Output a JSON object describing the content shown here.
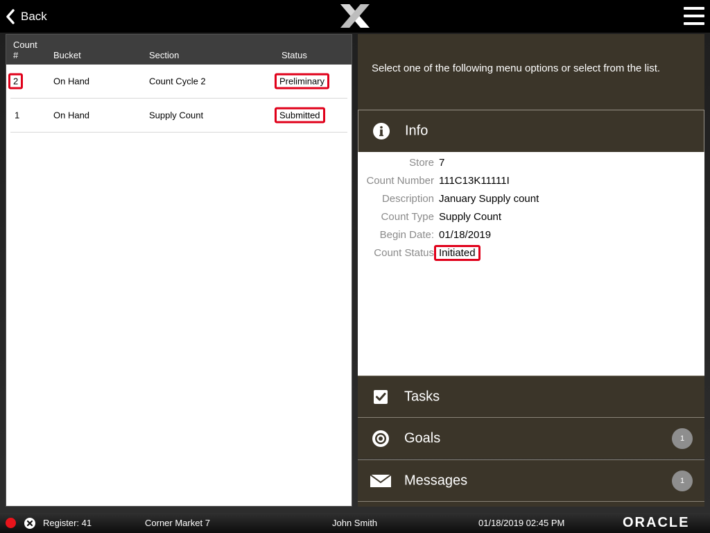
{
  "topbar": {
    "back_label": "Back"
  },
  "list": {
    "headers": {
      "count": "Count\n#",
      "count_line1": "Count",
      "count_line2": "#",
      "bucket": "Bucket",
      "section": "Section",
      "status": "Status"
    },
    "rows": [
      {
        "count": "2",
        "bucket": "On Hand",
        "section": "Count Cycle 2",
        "status": "Preliminary"
      },
      {
        "count": "1",
        "bucket": "On Hand",
        "section": "Supply Count",
        "status": "Submitted"
      }
    ]
  },
  "right": {
    "intro": "Select one of the following menu options or select from the list.",
    "info_title": "Info",
    "info": [
      {
        "label": "Store",
        "value": "7"
      },
      {
        "label": "Count Number",
        "value": "111C13K11111I"
      },
      {
        "label": "Description",
        "value": "January Supply count"
      },
      {
        "label": "Count Type",
        "value": "Supply Count"
      },
      {
        "label": "Begin Date:",
        "value": "01/18/2019"
      },
      {
        "label": "Count Status",
        "value": "Initiated"
      }
    ],
    "nav": [
      {
        "label": "Tasks",
        "icon": "checkbox-icon"
      },
      {
        "label": "Goals",
        "icon": "target-icon",
        "badge": "1"
      },
      {
        "label": "Messages",
        "icon": "envelope-icon",
        "badge": "1"
      }
    ]
  },
  "statusbar": {
    "register": "Register: 41",
    "store": "Corner Market 7",
    "user": "John Smith",
    "datetime": "01/18/2019 02:45 PM",
    "brand": "ORACLE"
  },
  "colors": {
    "panel_brown": "#3b3529",
    "highlight_red": "#e0001a",
    "status_red": "#e8141b"
  }
}
